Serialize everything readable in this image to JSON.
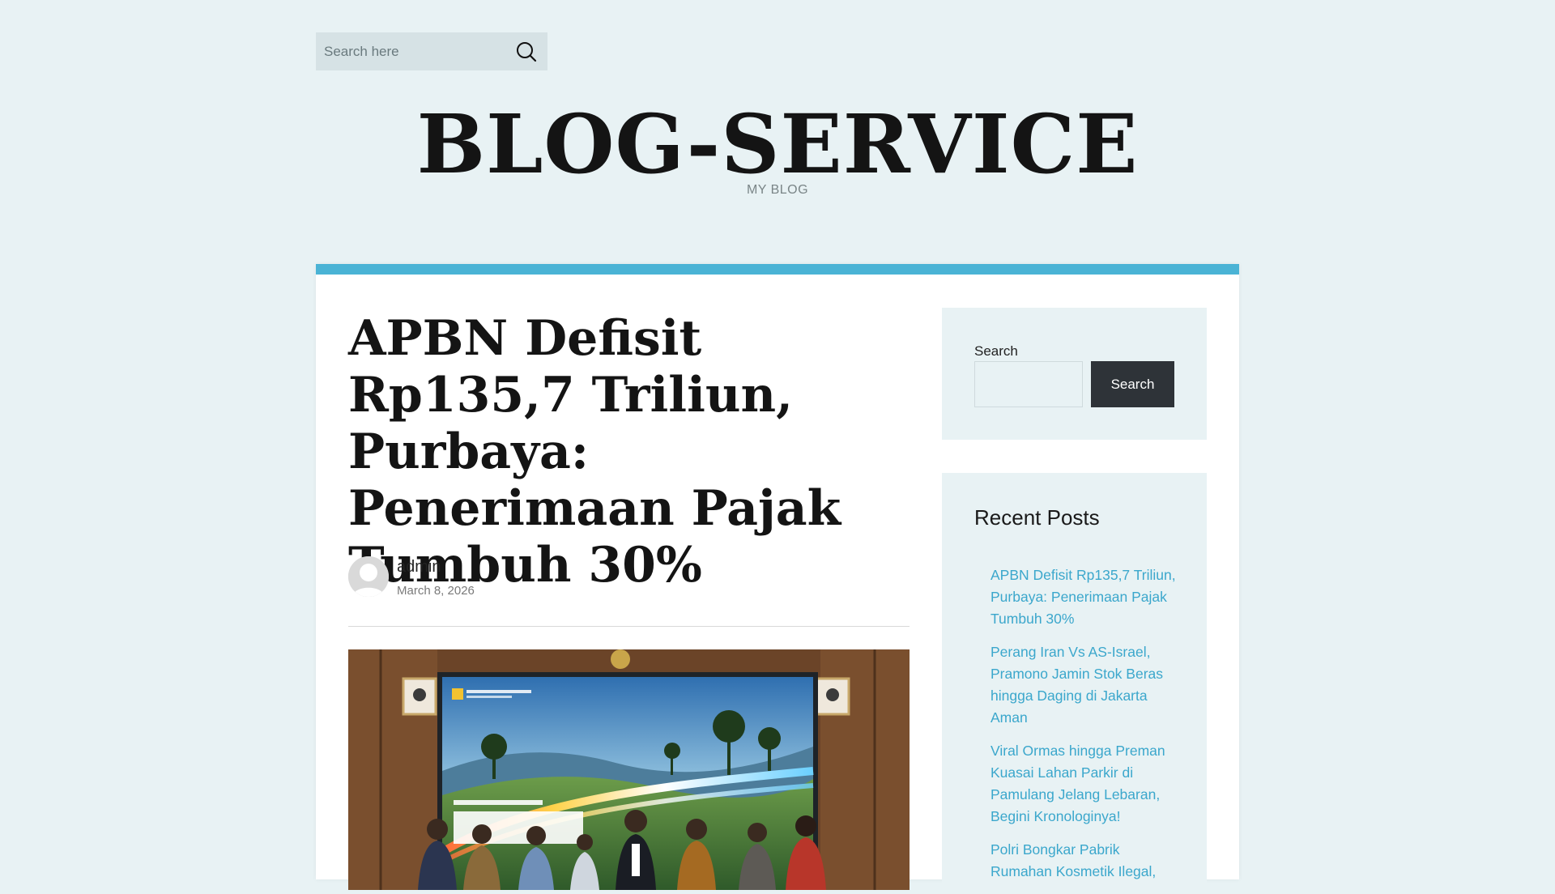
{
  "header": {
    "search_placeholder": "Search here",
    "site_title": "BLOG-SERVICE",
    "tagline": "MY BLOG"
  },
  "colors": {
    "accent": "#4ab3d5",
    "link": "#3ba7cc",
    "page_background": "#e8f2f4",
    "button_dark": "#2e3338"
  },
  "post": {
    "title": "APBN Defisit Rp135,7 Triliun, Purbaya: Penerimaan Pajak Tumbuh 30%",
    "author": "admin",
    "date": "March 8, 2026"
  },
  "sidebar": {
    "search": {
      "label": "Search",
      "button_label": "Search"
    },
    "recent_posts": {
      "heading": "Recent Posts",
      "items": [
        "APBN Defisit Rp135,7 Triliun, Purbaya: Penerimaan Pajak Tumbuh 30%",
        "Perang Iran Vs AS-Israel, Pramono Jamin Stok Beras hingga Daging di Jakarta Aman",
        "Viral Ormas hingga Preman Kuasai Lahan Parkir di Pamulang Jelang Lebaran, Begini Kronologinya!",
        "Polri Bongkar Pabrik Rumahan Kosmetik Ilegal,"
      ]
    }
  }
}
